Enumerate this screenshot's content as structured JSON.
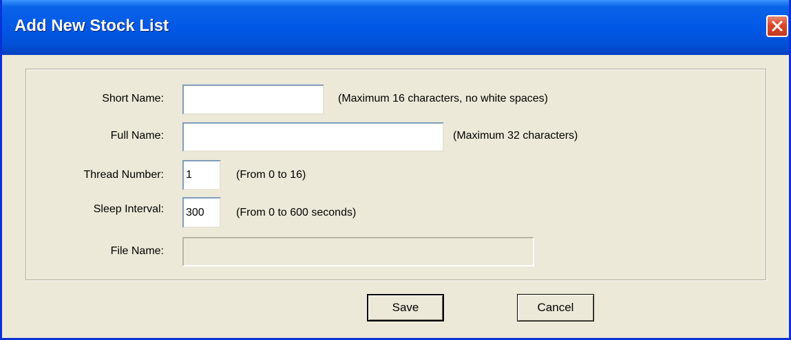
{
  "window": {
    "title": "Add New Stock List",
    "close_icon": "close-icon"
  },
  "form": {
    "short_name": {
      "label": "Short Name:",
      "value": "",
      "hint": "(Maximum 16 characters, no white spaces)"
    },
    "full_name": {
      "label": "Full Name:",
      "value": "",
      "hint": "(Maximum 32 characters)"
    },
    "thread_number": {
      "label": "Thread Number:",
      "value": "1",
      "hint": "(From 0 to 16)"
    },
    "sleep_interval": {
      "label": "Sleep Interval:",
      "value": "300",
      "hint": "(From 0 to 600 seconds)"
    },
    "file_name": {
      "label": "File Name:",
      "value": ""
    }
  },
  "buttons": {
    "save_label": "Save",
    "cancel_label": "Cancel"
  },
  "colors": {
    "titlebar": "#0058e6",
    "window_bg": "#ece9d8",
    "close_button": "#d9462a"
  }
}
